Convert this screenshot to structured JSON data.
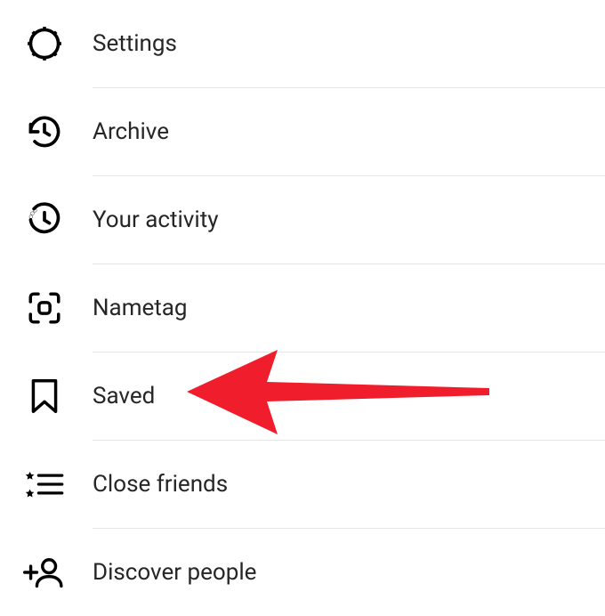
{
  "menu": {
    "items": [
      {
        "id": "settings",
        "label": "Settings"
      },
      {
        "id": "archive",
        "label": "Archive"
      },
      {
        "id": "your-activity",
        "label": "Your activity"
      },
      {
        "id": "nametag",
        "label": "Nametag"
      },
      {
        "id": "saved",
        "label": "Saved"
      },
      {
        "id": "close-friends",
        "label": "Close friends"
      },
      {
        "id": "discover-people",
        "label": "Discover people"
      }
    ]
  },
  "annotation": {
    "arrow_color": "#f01e2c",
    "target": "saved"
  }
}
